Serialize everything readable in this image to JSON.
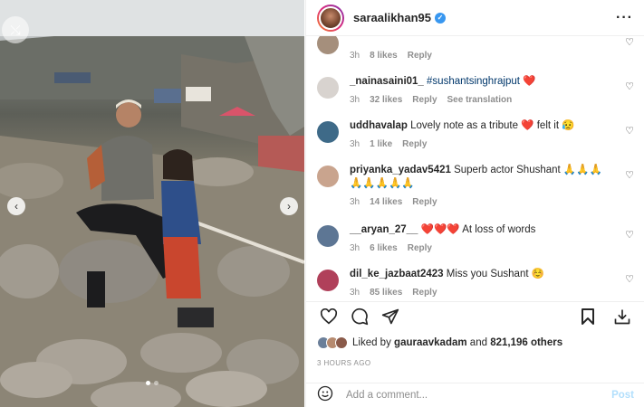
{
  "post": {
    "username": "saraalikhan95",
    "verified": true,
    "more_icon": "more-horizontal-icon"
  },
  "comments": [
    {
      "user": "",
      "text": "",
      "time": "3h",
      "likes": "8 likes",
      "reply": "Reply",
      "translate": ""
    },
    {
      "user": "_nainasaini01_",
      "tag": "#sushantsinghrajput",
      "text": "❤️",
      "time": "3h",
      "likes": "32 likes",
      "reply": "Reply",
      "translate": "See translation"
    },
    {
      "user": "uddhavalap",
      "text": "Lovely note as a tribute ❤️  felt it 😥",
      "time": "3h",
      "likes": "1 like",
      "reply": "Reply"
    },
    {
      "user": "priyanka_yadav5421",
      "text": "Superb actor Shushant 🙏🙏🙏🙏🙏🙏🙏🙏",
      "time": "3h",
      "likes": "14 likes",
      "reply": "Reply"
    },
    {
      "user": "__aryan_27__",
      "text": "❤️❤️❤️ At loss of words",
      "time": "3h",
      "likes": "6 likes",
      "reply": "Reply"
    },
    {
      "user": "dil_ke_jazbaat2423",
      "text": "Miss you Sushant ☺️",
      "time": "3h",
      "likes": "85 likes",
      "reply": "Reply"
    }
  ],
  "likes": {
    "prefix": "Liked by",
    "user": "gauraavkadam",
    "and": "and",
    "others": "821,196 others"
  },
  "timestamp": "3 HOURS AGO",
  "add_comment": {
    "placeholder": "Add a comment...",
    "post_label": "Post"
  },
  "colors": {
    "link": "#00376b",
    "verified": "#3897f0",
    "post_disabled": "#b2dffc",
    "muted": "#8e8e8e"
  }
}
